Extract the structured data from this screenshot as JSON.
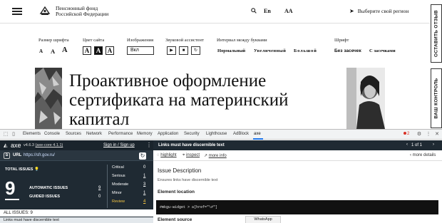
{
  "site": {
    "logo_line1": "Пенсионный фонд",
    "logo_line2": "Российской Федерации",
    "lang": "En",
    "contrast": "АА",
    "region": "Выберите свой регион",
    "side_tabs": [
      "ОСТАВИТЬ ОТЗЫВ",
      "ВАШ КОНТРОЛЬ"
    ],
    "accessibility": {
      "font_size_label": "Размер шрифта",
      "font_sizes": [
        "А",
        "А",
        "А"
      ],
      "color_label": "Цвет сайта",
      "colors": [
        "А",
        "А",
        "А"
      ],
      "images_label": "Изображения",
      "images_value": "Вкл",
      "audio_label": "Звуковой ассистент",
      "audio_buttons": [
        "▶",
        "■",
        "↻"
      ],
      "spacing_label": "Интервал между буквами",
      "spacing_options": [
        "Нормальный",
        "Увеличенный",
        "Большой"
      ],
      "font_label": "Шрифт",
      "font_options": [
        "Без засечек",
        "С засечками"
      ]
    },
    "headline": "Проактивное оформление сертификата на материнский капитал"
  },
  "devtools": {
    "tabs": [
      "Elements",
      "Console",
      "Sources",
      "Network",
      "Performance",
      "Memory",
      "Application",
      "Security",
      "Lighthouse",
      "AdBlock",
      "axe"
    ],
    "active_tab": "axe",
    "error_count": "2",
    "axe": {
      "logo": "axe",
      "version": "v4.6.3",
      "core_version": "(axe-core 4.1.1)",
      "sign_in": "Sign in / Sign up",
      "url_label": "URL",
      "url_value": "https://sfr.gov.ru/",
      "total_label": "TOTAL ISSUES",
      "total": "9",
      "automatic_label": "AUTOMATIC ISSUES",
      "automatic": "9",
      "guided_label": "GUIDED ISSUES",
      "guided": "0",
      "severities": [
        {
          "label": "Critical",
          "value": "0"
        },
        {
          "label": "Serious",
          "value": "1"
        },
        {
          "label": "Moderate",
          "value": "3"
        },
        {
          "label": "Minor",
          "value": "1"
        },
        {
          "label": "Review",
          "value": "4"
        }
      ],
      "all_issues": "ALL ISSUES: 9",
      "issue_item": "Links must have discernible text"
    },
    "detail": {
      "title": "Links must have discernible text",
      "pager": "1 of 1",
      "highlight": "highlight",
      "inspect": "inspect",
      "more_info": "more info",
      "more_details": "more details",
      "section_title": "Issue Description",
      "section_sub": "Ensures links have discernible text",
      "element_location": "Element location",
      "code": "#mkgu-widget > a[href=\"\\#\"]",
      "element_source": "Element source",
      "whatsapp": "WhatsApp"
    }
  }
}
